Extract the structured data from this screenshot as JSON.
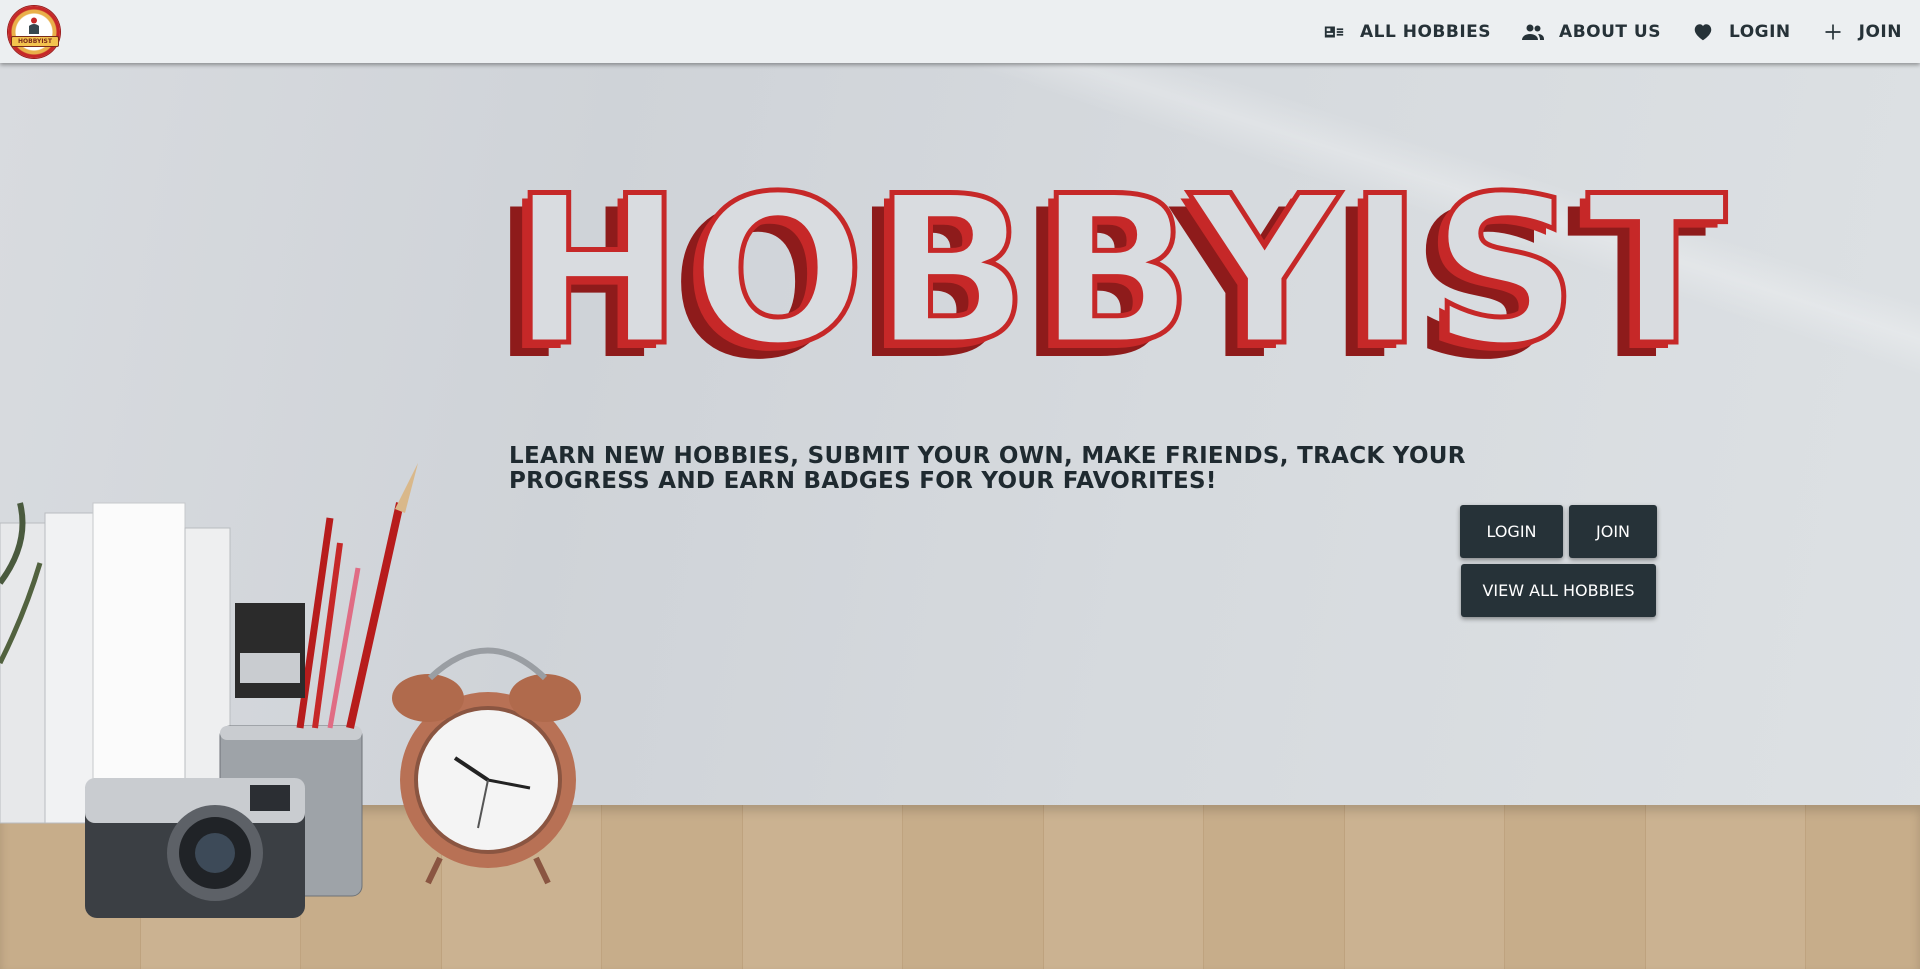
{
  "brand": {
    "logo_text": "HOBBYIST"
  },
  "nav": {
    "items": [
      {
        "label": "All Hobbies",
        "icon": "card-list-icon"
      },
      {
        "label": "About Us",
        "icon": "people-icon"
      },
      {
        "label": "Login",
        "icon": "heart-icon"
      },
      {
        "label": "Join",
        "icon": "plus-icon"
      }
    ]
  },
  "hero": {
    "title": "HOBBYIST",
    "tagline": "Learn new hobbies, submit your own, make friends, track your progress and earn badges for your favorites!",
    "buttons": {
      "login": "Login",
      "join": "Join",
      "view_all": "View All Hobbies"
    }
  },
  "colors": {
    "navbar_bg": "#eceff1",
    "text_dark": "#263238",
    "title_red": "#c62828",
    "button_bg": "#263238"
  }
}
